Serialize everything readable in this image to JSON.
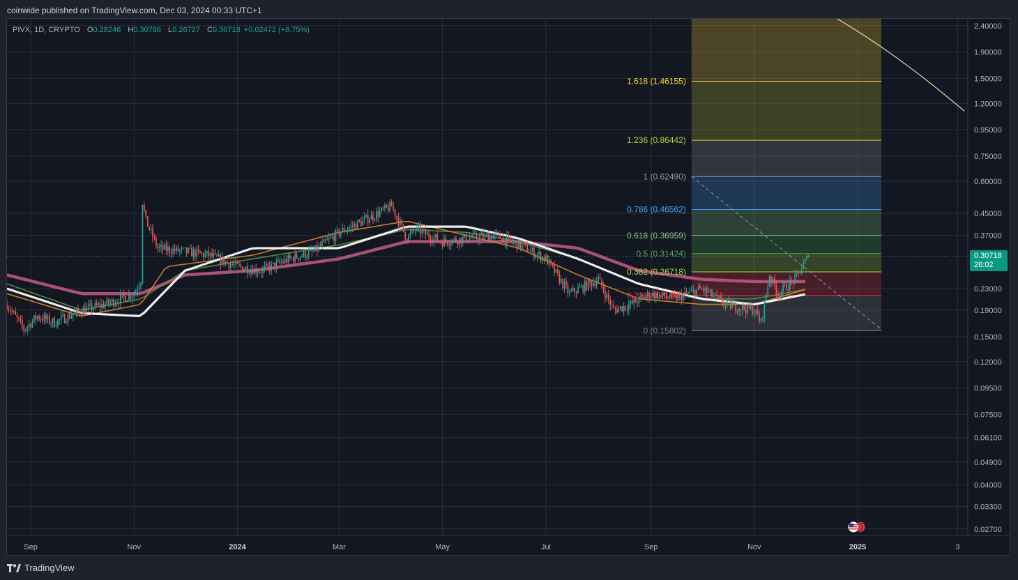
{
  "header": {
    "publish_note": "coinwide published on TradingView.com, Dec 03, 2024 00:33 UTC+1"
  },
  "legend": {
    "symbol": "PIVX, 1D, CRYPTO",
    "o_key": "O",
    "o_val": "0.28246",
    "h_key": "H",
    "h_val": "0.30788",
    "l_key": "L",
    "l_val": "0.26727",
    "c_key": "C",
    "c_val": "0.30718",
    "change": "+0.02472 (+8.75%)"
  },
  "price_tag": {
    "price": "0.30718",
    "countdown": "26:02"
  },
  "brand": {
    "name": "TradingView",
    "icon": "tradingview-logo-icon"
  },
  "colors": {
    "background": "#131722",
    "grid": "#2a2e39",
    "up": "#26a69a",
    "down": "#ef5350",
    "sma_white": "#ffffff",
    "sma_pink": "#b5577d",
    "ema_orange": "#d8862a",
    "ema_green": "#5f8f3f"
  },
  "chart_data": {
    "type": "candlestick",
    "scale": "log",
    "x_axis": {
      "labels": [
        "Sep",
        "Nov",
        "2024",
        "Mar",
        "May",
        "Jul",
        "Sep",
        "Nov",
        "2025",
        "3"
      ]
    },
    "y_axis": {
      "labels": [
        "2.40000",
        "1.90000",
        "1.50000",
        "1.20000",
        "0.95000",
        "0.75000",
        "0.60000",
        "0.45000",
        "0.37000",
        "0.23000",
        "0.19000",
        "0.15000",
        "0.12000",
        "0.09500",
        "0.07500",
        "0.06100",
        "0.04900",
        "0.04000",
        "0.03300",
        "0.02700"
      ],
      "range": [
        0.0255,
        2.55
      ]
    },
    "price_path": {
      "dates": [
        "2023-08-18",
        "2023-08-28",
        "2023-09-05",
        "2023-09-15",
        "2023-10-01",
        "2023-10-15",
        "2023-11-01",
        "2023-11-05",
        "2023-11-06",
        "2023-11-08",
        "2023-11-15",
        "2023-12-01",
        "2023-12-15",
        "2024-01-01",
        "2024-01-15",
        "2024-02-01",
        "2024-02-15",
        "2024-03-01",
        "2024-03-15",
        "2024-04-01",
        "2024-04-10",
        "2024-04-15",
        "2024-05-01",
        "2024-05-15",
        "2024-06-01",
        "2024-06-15",
        "2024-07-01",
        "2024-07-15",
        "2024-08-01",
        "2024-08-10",
        "2024-08-20",
        "2024-09-01",
        "2024-09-15",
        "2024-10-01",
        "2024-10-15",
        "2024-11-01",
        "2024-11-05",
        "2024-11-10",
        "2024-11-15",
        "2024-11-25",
        "2024-12-03"
      ],
      "close": [
        0.2,
        0.16,
        0.18,
        0.17,
        0.19,
        0.2,
        0.22,
        0.25,
        0.5,
        0.42,
        0.33,
        0.32,
        0.31,
        0.28,
        0.27,
        0.3,
        0.32,
        0.38,
        0.42,
        0.48,
        0.36,
        0.39,
        0.35,
        0.36,
        0.37,
        0.34,
        0.3,
        0.22,
        0.25,
        0.19,
        0.2,
        0.22,
        0.21,
        0.23,
        0.2,
        0.19,
        0.17,
        0.26,
        0.22,
        0.25,
        0.30718
      ]
    },
    "moving_averages": [
      {
        "color": "white",
        "dates": [
          "2023-08-18",
          "2023-10-01",
          "2023-11-05",
          "2023-12-01",
          "2024-01-10",
          "2024-03-01",
          "2024-04-10",
          "2024-05-15",
          "2024-06-15",
          "2024-07-20",
          "2024-08-25",
          "2024-10-01",
          "2024-11-01",
          "2024-12-03"
        ],
        "values": [
          0.23,
          0.185,
          0.18,
          0.27,
          0.33,
          0.33,
          0.4,
          0.4,
          0.36,
          0.3,
          0.24,
          0.21,
          0.2,
          0.22
        ]
      },
      {
        "color": "pink",
        "dates": [
          "2023-08-18",
          "2023-10-01",
          "2023-11-05",
          "2023-12-01",
          "2024-01-10",
          "2024-03-01",
          "2024-04-10",
          "2024-05-15",
          "2024-06-15",
          "2024-07-20",
          "2024-08-25",
          "2024-10-01",
          "2024-11-01",
          "2024-12-03"
        ],
        "values": [
          0.26,
          0.22,
          0.22,
          0.26,
          0.27,
          0.3,
          0.35,
          0.35,
          0.35,
          0.33,
          0.27,
          0.25,
          0.245,
          0.245
        ]
      },
      {
        "color": "orange",
        "dates": [
          "2023-08-18",
          "2023-10-01",
          "2023-11-05",
          "2023-11-20",
          "2024-01-10",
          "2024-03-01",
          "2024-04-10",
          "2024-05-15",
          "2024-06-15",
          "2024-07-20",
          "2024-08-25",
          "2024-10-01",
          "2024-11-01",
          "2024-12-03"
        ],
        "values": [
          0.22,
          0.18,
          0.2,
          0.28,
          0.31,
          0.38,
          0.42,
          0.37,
          0.33,
          0.26,
          0.21,
          0.2,
          0.2,
          0.23
        ]
      },
      {
        "color": "green",
        "dates": [
          "2023-08-18",
          "2023-10-01",
          "2023-11-05",
          "2023-12-01",
          "2024-01-10",
          "2024-03-01",
          "2024-04-10",
          "2024-05-15",
          "2024-06-15",
          "2024-07-20",
          "2024-08-25",
          "2024-10-01",
          "2024-11-01",
          "2024-12-03"
        ],
        "values": [
          0.24,
          0.19,
          0.21,
          0.27,
          0.3,
          0.34,
          0.39,
          0.38,
          0.35,
          0.3,
          0.24,
          0.21,
          0.21,
          0.23
        ]
      }
    ],
    "fibonacci": {
      "start_date": "2024-09-25",
      "end_date": "2025-01-15",
      "levels": [
        {
          "ratio": "0",
          "price": 0.15802,
          "label": "0 (0.15802)",
          "color": "#808080"
        },
        {
          "ratio": "0.236",
          "price": 0.2164,
          "label": "0.236 (0.21640)",
          "color": "#f23645"
        },
        {
          "ratio": "0.382",
          "price": 0.26718,
          "label": "0.382 (0.26718)",
          "color": "#a5d63f"
        },
        {
          "ratio": "0.5",
          "price": 0.31424,
          "label": "0.5 (0.31424)",
          "color": "#4caf50"
        },
        {
          "ratio": "0.618",
          "price": 0.36959,
          "label": "0.618 (0.36959)",
          "color": "#81c784"
        },
        {
          "ratio": "0.786",
          "price": 0.46562,
          "label": "0.786 (0.46562)",
          "color": "#42a5f5"
        },
        {
          "ratio": "1",
          "price": 0.6249,
          "label": "1 (0.62490)",
          "color": "#9598a1"
        },
        {
          "ratio": "1.236",
          "price": 0.86442,
          "label": "1.236 (0.86442)",
          "color": "#c0ca33"
        },
        {
          "ratio": "1.618",
          "price": 1.46155,
          "label": "1.618 (1.46155)",
          "color": "#fdd835"
        },
        {
          "ratio": "2.618",
          "price": 2.55,
          "label": "",
          "color": "#e65100"
        }
      ]
    },
    "trend_line": {
      "from_date": "2024-09-25",
      "from_price": 0.6249,
      "to_date": "2025-01-15",
      "to_price": 0.16
    },
    "curve": {
      "dates": [
        "2024-12-20",
        "2025-01-25",
        "2025-03-05"
      ],
      "prices": [
        2.55,
        1.85,
        1.12
      ]
    },
    "last_price": 0.30718
  }
}
